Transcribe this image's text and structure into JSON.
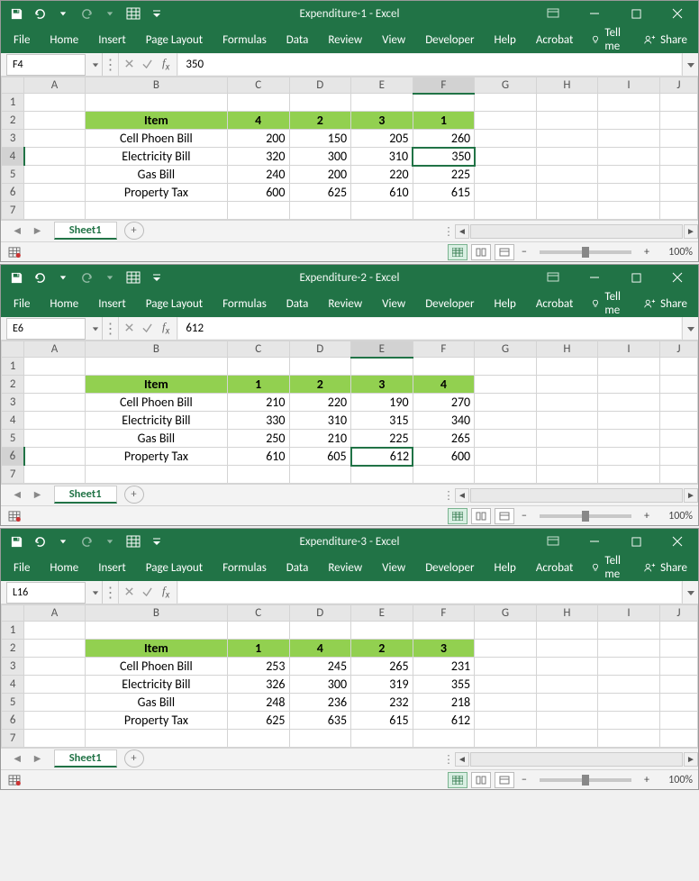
{
  "ribbon_tabs": [
    "File",
    "Home",
    "Insert",
    "Page Layout",
    "Formulas",
    "Data",
    "Review",
    "View",
    "Developer",
    "Help",
    "Acrobat"
  ],
  "tell_me": "Tell me",
  "share": "Share",
  "zoom": "100%",
  "columns": [
    "A",
    "B",
    "C",
    "D",
    "E",
    "F",
    "G",
    "H",
    "I",
    "J"
  ],
  "row_labels": [
    "1",
    "2",
    "3",
    "4",
    "5",
    "6",
    "7"
  ],
  "sheet_tab": "Sheet1",
  "windows": [
    {
      "title": "Expenditure-1  -  Excel",
      "namebox": "F4",
      "formula": "350",
      "sel_col_idx": 5,
      "sel_row_idx": 3,
      "table": {
        "header": [
          "Item",
          "4",
          "2",
          "3",
          "1"
        ],
        "rows": [
          [
            "Cell Phoen Bill",
            "200",
            "150",
            "205",
            "260"
          ],
          [
            "Electricity Bill",
            "320",
            "300",
            "310",
            "350"
          ],
          [
            "Gas Bill",
            "240",
            "200",
            "220",
            "225"
          ],
          [
            "Property Tax",
            "600",
            "625",
            "610",
            "615"
          ]
        ]
      }
    },
    {
      "title": "Expenditure-2  -  Excel",
      "namebox": "E6",
      "formula": "612",
      "sel_col_idx": 4,
      "sel_row_idx": 5,
      "table": {
        "header": [
          "Item",
          "1",
          "2",
          "3",
          "4"
        ],
        "rows": [
          [
            "Cell Phoen Bill",
            "210",
            "220",
            "190",
            "270"
          ],
          [
            "Electricity Bill",
            "330",
            "310",
            "315",
            "340"
          ],
          [
            "Gas Bill",
            "250",
            "210",
            "225",
            "265"
          ],
          [
            "Property Tax",
            "610",
            "605",
            "612",
            "600"
          ]
        ]
      }
    },
    {
      "title": "Expenditure-3  -  Excel",
      "namebox": "L16",
      "formula": "",
      "sel_col_idx": -1,
      "sel_row_idx": -1,
      "table": {
        "header": [
          "Item",
          "1",
          "4",
          "2",
          "3"
        ],
        "rows": [
          [
            "Cell Phoen Bill",
            "253",
            "245",
            "265",
            "231"
          ],
          [
            "Electricity Bill",
            "326",
            "300",
            "319",
            "355"
          ],
          [
            "Gas Bill",
            "248",
            "236",
            "232",
            "218"
          ],
          [
            "Property Tax",
            "625",
            "635",
            "615",
            "612"
          ]
        ]
      }
    }
  ]
}
